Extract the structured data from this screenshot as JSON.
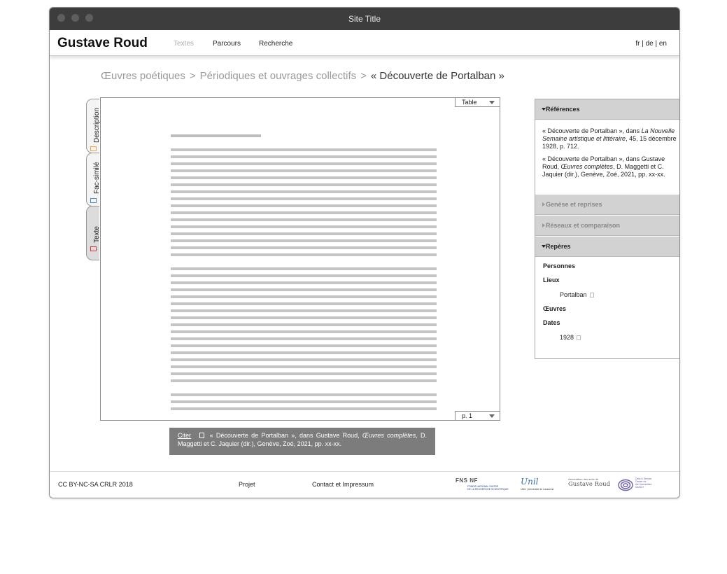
{
  "window": {
    "title": "Site Title"
  },
  "header": {
    "brand": "Gustave Roud",
    "nav": [
      "Textes",
      "Parcours",
      "Recherche"
    ],
    "langs": {
      "fr": "fr",
      "sep1": " | ",
      "de": "de",
      "sep2": " | ",
      "en": "en"
    }
  },
  "breadcrumb": {
    "items": [
      "Œuvres poétiques",
      "Périodiques et ouvrages collectifs"
    ],
    "separator": ">",
    "current": "« Découverte de Portalban »"
  },
  "tabs": {
    "description": "Description",
    "facsimile": "Fac-similé",
    "text": "Texte",
    "colors": {
      "description": "#e8a54a",
      "facsimile": "#4d8ab8",
      "text": "#c63a3a"
    }
  },
  "viewer": {
    "table_select": "Table",
    "page_select": "p. 1",
    "paragraph_line_counts": [
      16,
      17,
      3
    ]
  },
  "citation": {
    "link": "Citer",
    "icon": "copy-icon",
    "pre": "« Découverte de Portalban », dans Gustave Roud, ",
    "italic": "Œuvres complètes",
    "post": ", D. Maggetti et C. Jaquier (dir.), Genève, Zoé, 2021, pp. xx-xx."
  },
  "panel": {
    "references": {
      "title": "Références",
      "ref1_pre": "« Découverte de Portalban », dans ",
      "ref1_italic": "La Nouvelle Semaine artistique et littéraire",
      "ref1_post": ", 45, 15 décembre 1928, p. 712.",
      "ref2_pre": "« Découverte de Portalban », dans Gustave Roud, ",
      "ref2_italic": "Œuvres complètes",
      "ref2_post": ", D. Maggetti et C. Jaquier (dir.), Genève, Zoé, 2021, pp. xx-xx."
    },
    "genese": "Genèse et reprises",
    "reseaux": "Réseaux et comparaison",
    "reperes": {
      "title": "Repères",
      "personnes": "Personnes",
      "lieux": "Lieux",
      "lieux_item": "Portalban",
      "oeuvres": "Œuvres",
      "dates": "Dates",
      "dates_item": "1928"
    }
  },
  "footer": {
    "license": "CC BY-NC-SA CRLR 2018",
    "projet": "Projet",
    "contact": "Contact et Impressum",
    "logos": {
      "fns": "FNS NF",
      "fns_small1": "FONDS NATIONAL SUISSE",
      "fns_small2": "DE LA RECHERCHE SCIENTIFIQUE",
      "unil": "Unil",
      "unil_small": "UNIL | Université de Lausanne",
      "roud_small": "Association des amis de",
      "roud": "Gustave Roud",
      "dasch1": "Data & Service",
      "dasch2": "Center for",
      "dasch3": "the Humanities",
      "dasch4": "DaSCH"
    }
  }
}
